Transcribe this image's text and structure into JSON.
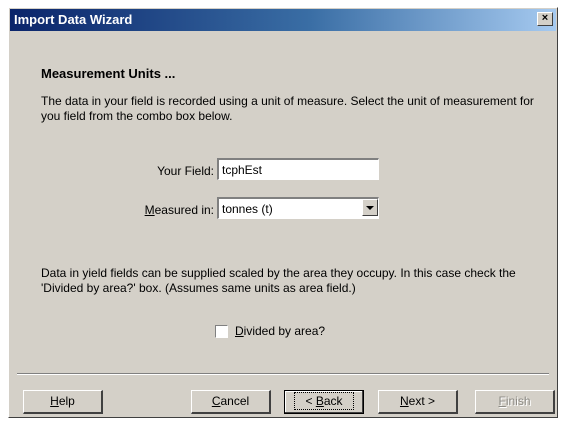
{
  "window": {
    "title": "Import Data Wizard",
    "close_glyph": "×"
  },
  "page": {
    "heading": "Measurement Units ...",
    "intro": "The data in your field is recorded using a unit of measure.  Select the unit of measurement for you field from the combo box below.",
    "your_field_label": "Your Field:",
    "your_field_value": "tcphEst",
    "measured_in_label_mnemonic": "M",
    "measured_in_label_rest": "easured in:",
    "measured_in_value": "tonnes (t)",
    "yield_note": "Data in yield fields can be supplied scaled by the area they occupy.  In this case check the 'Divided by area?' box. (Assumes same units as area field.)",
    "divided_checkbox_mnemonic": "D",
    "divided_checkbox_rest": "ivided by area?",
    "divided_checked": false
  },
  "buttons": {
    "help_mnemonic": "H",
    "help_rest": "elp",
    "cancel_mnemonic": "C",
    "cancel_rest": "ancel",
    "back_prefix": "< ",
    "back_mnemonic": "B",
    "back_rest": "ack",
    "next_mnemonic": "N",
    "next_rest": "ext >",
    "finish_mnemonic": "F",
    "finish_rest": "inish"
  }
}
